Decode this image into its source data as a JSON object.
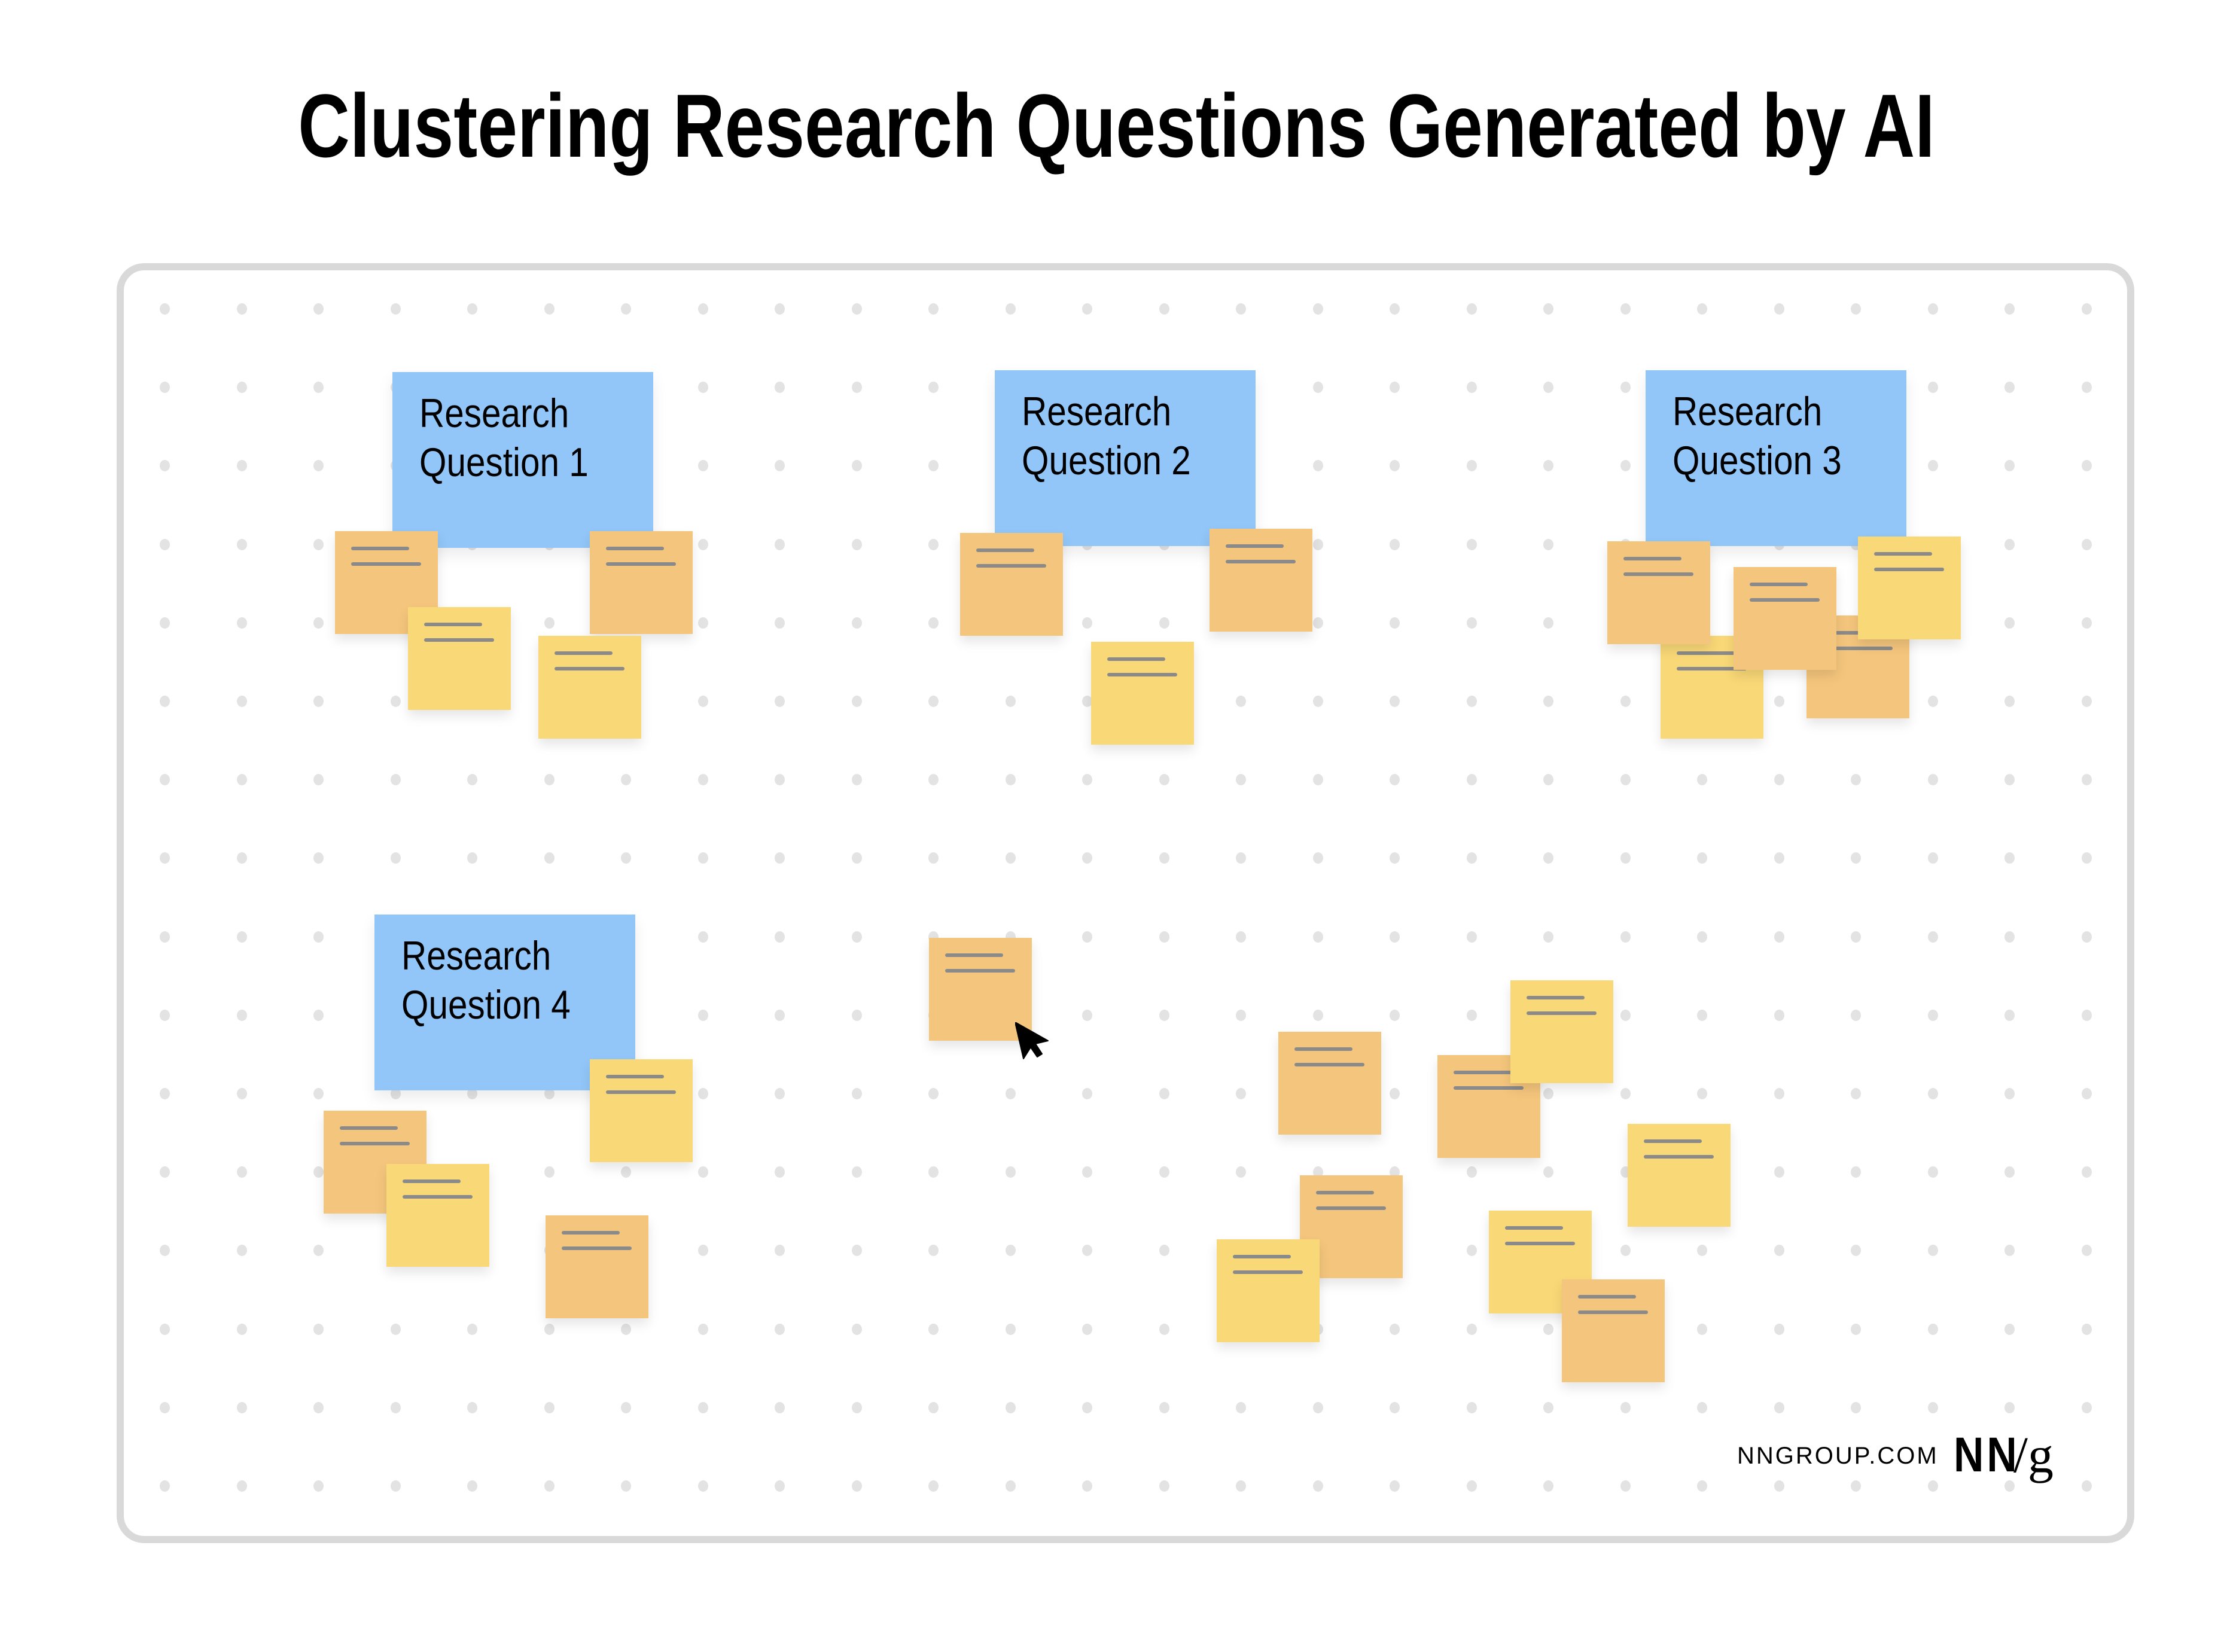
{
  "title": "Clustering Research Questions Generated by AI",
  "colors": {
    "question_card": "#92C6F8",
    "note_orange": "#F4C57C",
    "note_yellow": "#F9D877",
    "board_border": "#D9D9D9",
    "grid_dot": "#E3E3E3",
    "note_line": "#8A8A8A"
  },
  "question_cards": [
    {
      "line1": "Research",
      "line2": "Question 1"
    },
    {
      "line1": "Research",
      "line2": "Question 2"
    },
    {
      "line1": "Research",
      "line2": "Question 3"
    },
    {
      "line1": "Research",
      "line2": "Question 4"
    }
  ],
  "clusters": [
    {
      "label": "Research Question 1",
      "note_count": 4,
      "note_colors": [
        "orange",
        "orange",
        "yellow",
        "yellow"
      ]
    },
    {
      "label": "Research Question 2",
      "note_count": 3,
      "note_colors": [
        "orange",
        "orange",
        "yellow"
      ]
    },
    {
      "label": "Research Question 3",
      "note_count": 5,
      "note_colors": [
        "yellow",
        "orange",
        "orange",
        "orange",
        "yellow"
      ]
    },
    {
      "label": "Research Question 4",
      "note_count": 4,
      "note_colors": [
        "orange",
        "yellow",
        "yellow",
        "orange"
      ]
    },
    {
      "label": "Unclustered (being dragged)",
      "note_count": 1,
      "note_colors": [
        "orange"
      ]
    },
    {
      "label": "Unclustered group",
      "note_count": 8,
      "note_colors": [
        "orange",
        "orange",
        "yellow",
        "yellow",
        "orange",
        "yellow",
        "yellow",
        "orange"
      ]
    }
  ],
  "cursor": {
    "icon": "pointer-arrow-icon"
  },
  "footer": {
    "url": "NNGROUP.COM",
    "logo_nn": "NN",
    "logo_slash_g": "/g"
  }
}
